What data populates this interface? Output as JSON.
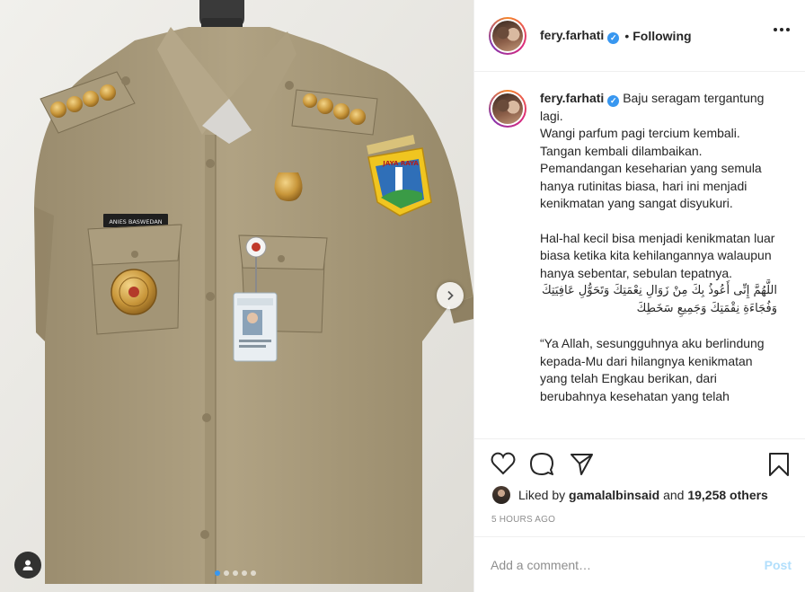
{
  "post": {
    "username": "fery.farhati",
    "verified_icon": "verified-badge-icon",
    "separator": "•",
    "follow_status": "Following",
    "more_icon": "more-options-icon"
  },
  "caption": {
    "username": "fery.farhati",
    "paragraphs": [
      "Baju seragam tergantung lagi.",
      "Wangi parfum pagi tercium kembali.",
      "Tangan kembali dilambaikan.",
      "Pemandangan keseharian yang semula hanya rutinitas biasa, hari ini menjadi kenikmatan yang sangat disyukuri."
    ],
    "paragraph2": "Hal-hal kecil bisa menjadi kenikmatan luar biasa ketika kita kehilangannya walaupun hanya sebentar, sebulan tepatnya.",
    "arabic": "اللَّهُمَّ إِنِّى أَعُوذُ بِكَ مِنْ زَوَالِ نِعْمَتِكَ وَتَحَوُّلِ عَافِيَتِكَ وَفُجَاءَةِ نِقْمَتِكَ وَجَمِيعِ سَخَطِكَ",
    "translation": "“Ya Allah, sesungguhnya aku berlindung kepada-Mu dari hilangnya kenikmatan yang telah Engkau berikan, dari berubahnya kesehatan yang telah"
  },
  "actions": {
    "like_icon": "heart-icon",
    "comment_icon": "comment-icon",
    "share_icon": "share-icon",
    "save_icon": "bookmark-icon"
  },
  "likes": {
    "prefix": "Liked by",
    "user": "gamalalbinsaid",
    "connector": "and",
    "count": "19,258 others"
  },
  "timestamp": "5 HOURS AGO",
  "comment": {
    "placeholder": "Add a comment…",
    "post_label": "Post"
  },
  "media": {
    "badge_text": "ANIES BASWEDAN",
    "patch_text": "JAYA RAYA",
    "carousel_total": 5,
    "carousel_active": 1,
    "next_icon": "chevron-right-icon",
    "tag_icon": "user-tag-icon"
  },
  "colors": {
    "accent": "#3897f0",
    "post_disabled": "#b2dffc",
    "shirt": "#a99a7b",
    "muted": "#8e8e8e"
  }
}
